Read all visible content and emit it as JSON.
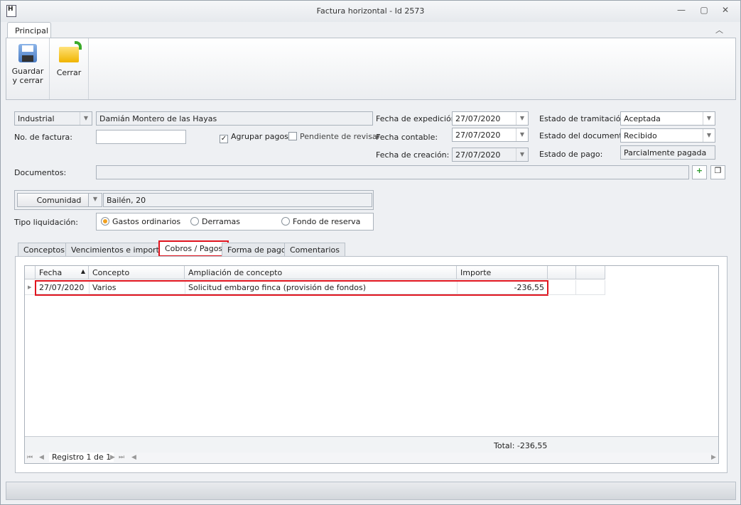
{
  "window": {
    "title": "Factura horizontal - Id 2573",
    "minimize": "—",
    "maximize": "▢",
    "close": "✕",
    "collapse": "︿"
  },
  "ribbon": {
    "tab": "Principal",
    "buttons": [
      {
        "label1": "Guardar",
        "label2": "y cerrar",
        "icon": "floppy-disk-icon"
      },
      {
        "label1": "Cerrar",
        "label2": "",
        "icon": "folder-icon"
      }
    ]
  },
  "form": {
    "tipo": "Industrial",
    "nombre": "Damián Montero de las Hayas",
    "no_factura_label": "No. de factura:",
    "no_factura": "",
    "agrupar_label": "Agrupar pagos",
    "agrupar": true,
    "pendiente_label": "Pendiente de revisar",
    "pendiente": false,
    "fecha_exp_label": "Fecha de expedición:",
    "fecha_exp": "27/07/2020",
    "fecha_cont_label": "Fecha contable:",
    "fecha_cont": "27/07/2020",
    "fecha_crea_label": "Fecha de creación:",
    "fecha_crea": "27/07/2020",
    "estado_tram_label": "Estado de tramitación:",
    "estado_tram": "Aceptada",
    "estado_doc_label": "Estado del documento:",
    "estado_doc": "Recibido",
    "estado_pago_label": "Estado de pago:",
    "estado_pago": "Parcialmente pagada",
    "documentos_label": "Documentos:",
    "documentos": "",
    "comunidad_btn": "Comunidad",
    "comunidad": "Bailén, 20",
    "tipo_liq_label": "Tipo liquidación:",
    "tipo_liq_options": [
      "Gastos ordinarios",
      "Derramas",
      "Fondo de reserva"
    ],
    "tipo_liq_selected": "Gastos ordinarios"
  },
  "tabs": [
    "Conceptos",
    "Vencimientos e importes",
    "Cobros / Pagos",
    "Forma de pago",
    "Comentarios"
  ],
  "selected_tab": "Cobros / Pagos",
  "grid": {
    "columns": [
      "Fecha",
      "Concepto",
      "Ampliación de concepto",
      "Importe"
    ],
    "sort": "▲",
    "rows": [
      {
        "fecha": "27/07/2020",
        "concepto": "Varios",
        "ampliacion": "Solicitud embargo finca (provisión de fondos)",
        "importe": "-236,55"
      }
    ],
    "total": "Total: -236,55",
    "navigator": "Registro 1 de 1"
  },
  "colors": {
    "highlight": "#e0141e",
    "radio": "#f0a020"
  }
}
